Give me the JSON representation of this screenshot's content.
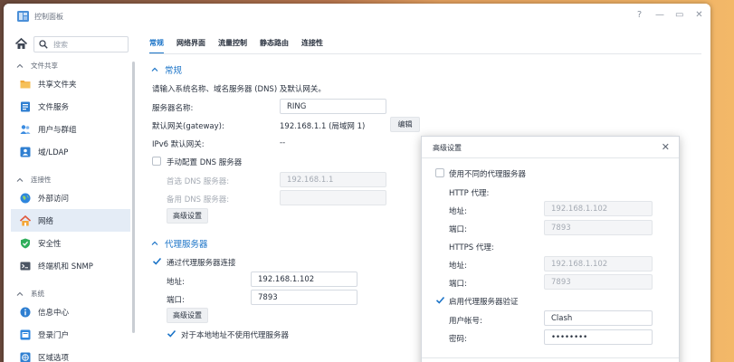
{
  "window": {
    "title": "控制面板"
  },
  "window_controls": [
    "?",
    "—",
    "▭",
    "✕"
  ],
  "sidebar": {
    "search_placeholder": "搜索",
    "groups": [
      {
        "label": "文件共享",
        "items": [
          {
            "label": "共享文件夹",
            "icon": "folder-icon"
          },
          {
            "label": "文件服务",
            "icon": "file-services-icon"
          },
          {
            "label": "用户与群组",
            "icon": "users-icon"
          },
          {
            "label": "域/LDAP",
            "icon": "domain-icon"
          }
        ]
      },
      {
        "label": "连接性",
        "items": [
          {
            "label": "外部访问",
            "icon": "globe-icon"
          },
          {
            "label": "网络",
            "icon": "network-house-icon",
            "active": true
          },
          {
            "label": "安全性",
            "icon": "shield-icon"
          },
          {
            "label": "终端机和 SNMP",
            "icon": "terminal-icon"
          }
        ]
      },
      {
        "label": "系统",
        "items": [
          {
            "label": "信息中心",
            "icon": "info-icon"
          },
          {
            "label": "登录门户",
            "icon": "login-portal-icon"
          },
          {
            "label": "区域选项",
            "icon": "region-icon"
          }
        ]
      }
    ]
  },
  "tabs": [
    "常规",
    "网络界面",
    "流量控制",
    "静态路由",
    "连接性"
  ],
  "general": {
    "section_title": "常规",
    "description": "请输入系统名称、域名服务器 (DNS) 及默认网关。",
    "server_name_label": "服务器名称:",
    "server_name_value": "RING",
    "gateway_label": "默认网关(gateway):",
    "gateway_value": "192.168.1.1 (局域网 1)",
    "edit_button": "编辑",
    "ipv6_gateway_label": "IPv6 默认网关:",
    "ipv6_gateway_value": "--",
    "manual_dns_label": "手动配置 DNS 服务器",
    "preferred_dns_label": "首选 DNS 服务器:",
    "preferred_dns_value": "192.168.1.1",
    "alternate_dns_label": "备用 DNS 服务器:",
    "alternate_dns_value": "",
    "advanced_button": "高级设置"
  },
  "proxy": {
    "section_title": "代理服务器",
    "connect_via_proxy_label": "通过代理服务器连接",
    "address_label": "地址:",
    "address_value": "192.168.1.102",
    "port_label": "端口:",
    "port_value": "7893",
    "advanced_button": "高级设置",
    "bypass_local_label": "对于本地地址不使用代理服务器"
  },
  "dialog": {
    "title": "高级设置",
    "use_different_proxy_label": "使用不同的代理服务器",
    "http_proxy_label": "HTTP 代理:",
    "http_address_label": "地址:",
    "http_address_value": "192.168.1.102",
    "http_port_label": "端口:",
    "http_port_value": "7893",
    "https_proxy_label": "HTTPS 代理:",
    "https_address_label": "地址:",
    "https_address_value": "192.168.1.102",
    "https_port_label": "端口:",
    "https_port_value": "7893",
    "enable_auth_label": "启用代理服务器验证",
    "username_label": "用户帐号:",
    "username_value": "Clash",
    "password_label": "密码:",
    "password_value": "••••••••"
  },
  "colors": {
    "accent": "#1a73c7",
    "active_bg": "#e4ecf6"
  }
}
